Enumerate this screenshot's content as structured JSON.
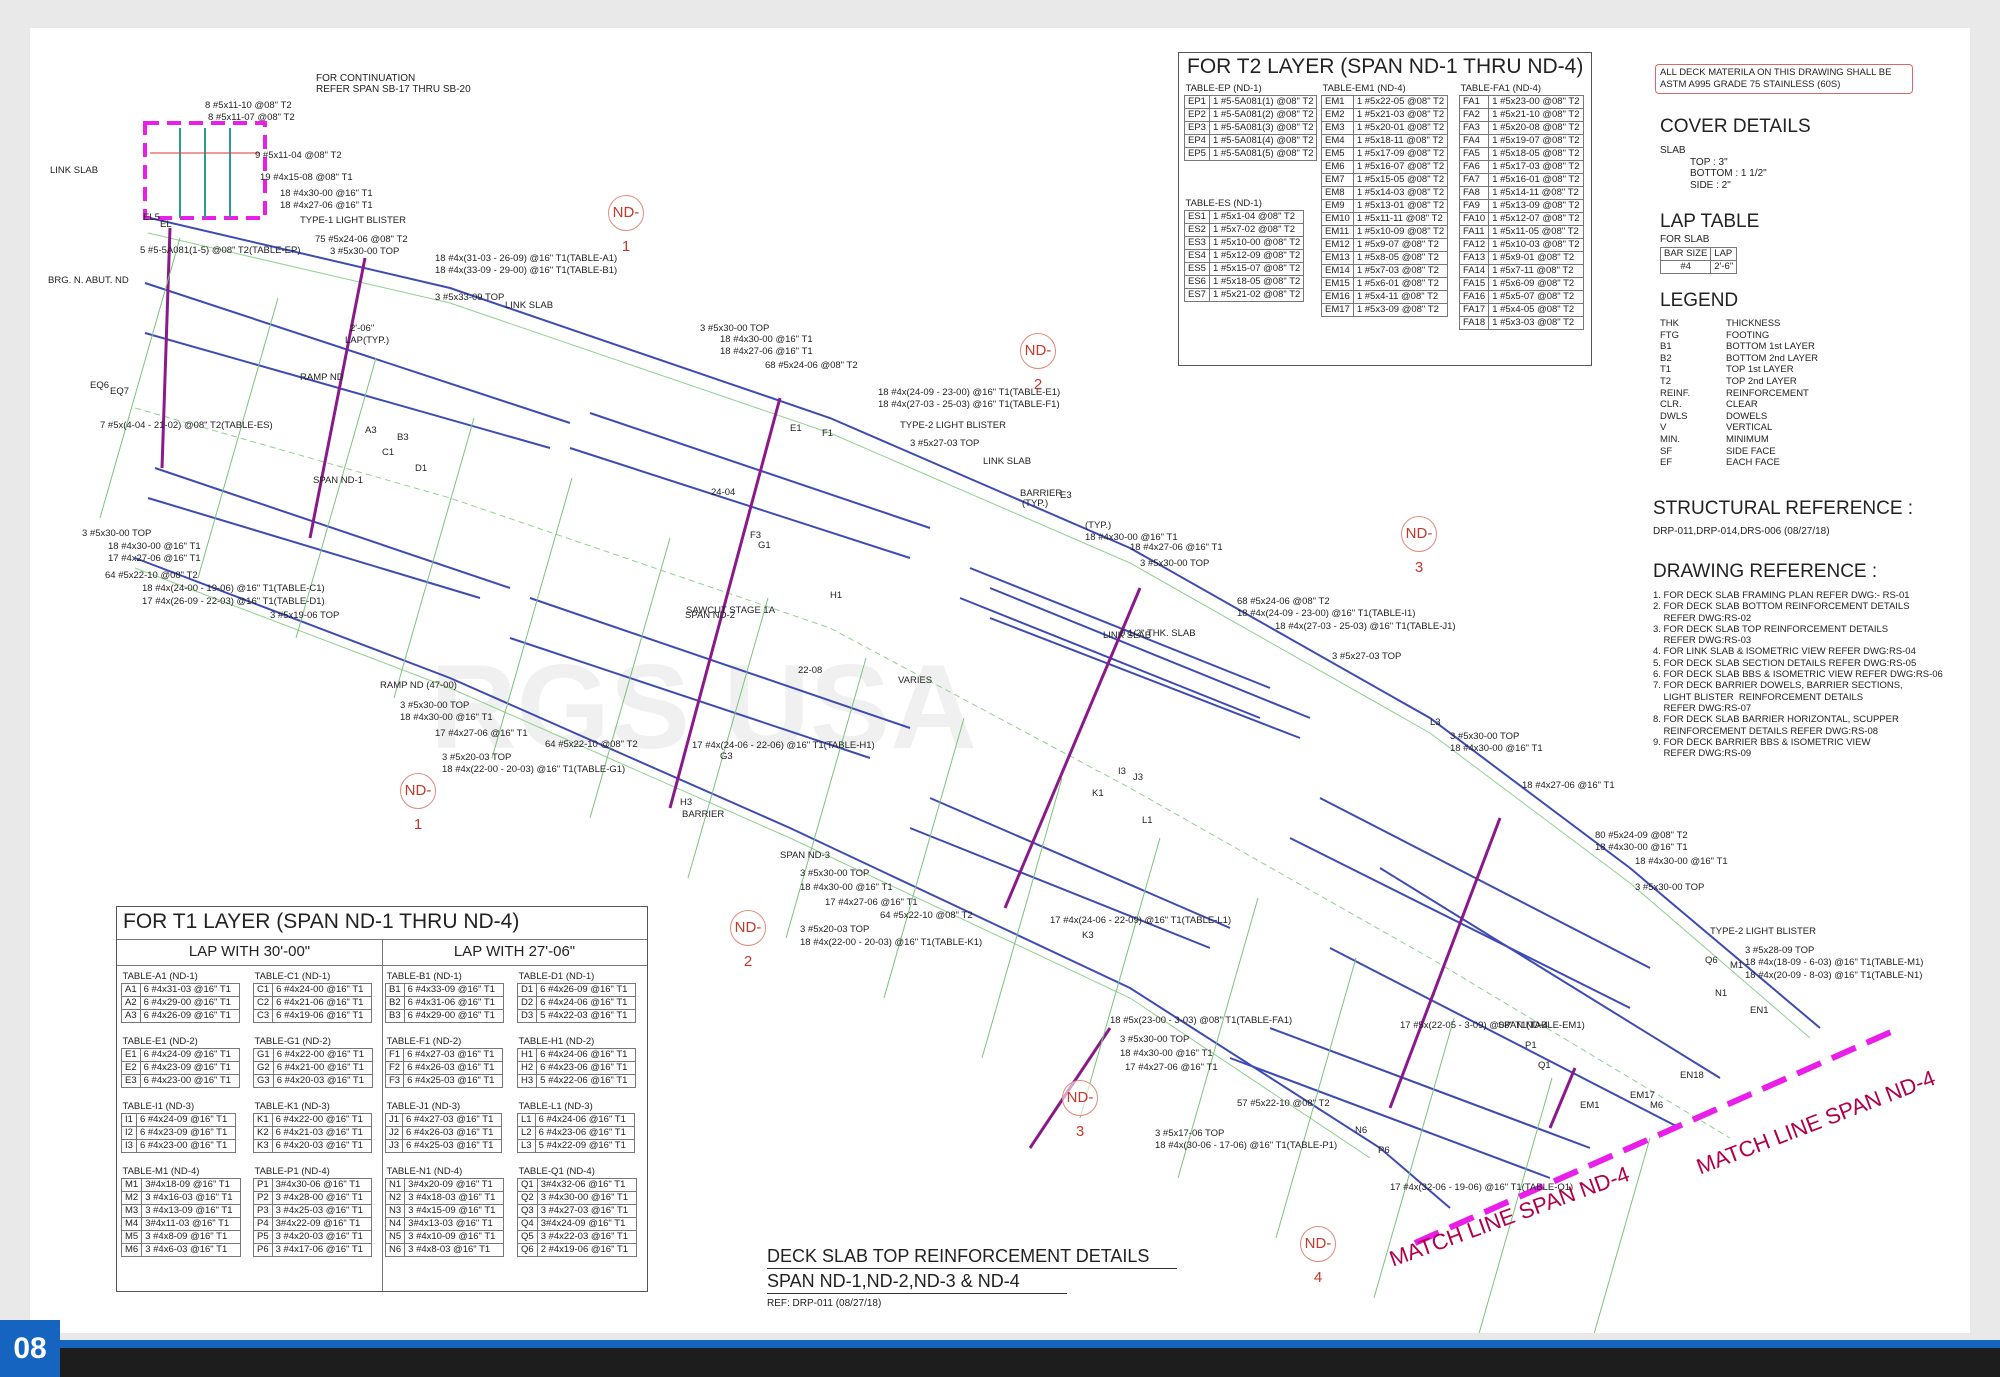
{
  "page_number": "08",
  "watermark": "RGS USA",
  "note_box": [
    "ALL DECK MATERILA ON THIS DRAWING SHALL BE",
    "ASTM A995 GRADE 75 STAINLESS (60S)"
  ],
  "continuation": [
    "FOR CONTINUATION",
    "REFER SPAN SB-17 THRU SB-20"
  ],
  "t2": {
    "title": "FOR T2 LAYER (SPAN ND-1 THRU ND-4)",
    "ep_title": "TABLE-EP (ND-1)",
    "ep": [
      [
        "EP1",
        "1 #5-5A081(1) @08\" T2"
      ],
      [
        "EP2",
        "1 #5-5A081(2) @08\" T2"
      ],
      [
        "EP3",
        "1 #5-5A081(3) @08\" T2"
      ],
      [
        "EP4",
        "1 #5-5A081(4) @08\" T2"
      ],
      [
        "EP5",
        "1 #5-5A081(5) @08\" T2"
      ]
    ],
    "es_title": "TABLE-ES (ND-1)",
    "es": [
      [
        "ES1",
        "1 #5x1-04 @08\" T2"
      ],
      [
        "ES2",
        "1 #5x7-02 @08\" T2"
      ],
      [
        "ES3",
        "1 #5x10-00 @08\" T2"
      ],
      [
        "ES4",
        "1 #5x12-09 @08\" T2"
      ],
      [
        "ES5",
        "1 #5x15-07 @08\" T2"
      ],
      [
        "ES6",
        "1 #5x18-05 @08\" T2"
      ],
      [
        "ES7",
        "1 #5x21-02 @08\" T2"
      ]
    ],
    "em_title": "TABLE-EM1 (ND-4)",
    "em": [
      [
        "EM1",
        "1 #5x22-05 @08\" T2"
      ],
      [
        "EM2",
        "1 #5x21-03 @08\" T2"
      ],
      [
        "EM3",
        "1 #5x20-01 @08\" T2"
      ],
      [
        "EM4",
        "1 #5x18-11 @08\" T2"
      ],
      [
        "EM5",
        "1 #5x17-09 @08\" T2"
      ],
      [
        "EM6",
        "1 #5x16-07 @08\" T2"
      ],
      [
        "EM7",
        "1 #5x15-05 @08\" T2"
      ],
      [
        "EM8",
        "1 #5x14-03 @08\" T2"
      ],
      [
        "EM9",
        "1 #5x13-01 @08\" T2"
      ],
      [
        "EM10",
        "1 #5x11-11 @08\" T2"
      ],
      [
        "EM11",
        "1 #5x10-09 @08\" T2"
      ],
      [
        "EM12",
        "1 #5x9-07 @08\" T2"
      ],
      [
        "EM13",
        "1 #5x8-05 @08\" T2"
      ],
      [
        "EM14",
        "1 #5x7-03 @08\" T2"
      ],
      [
        "EM15",
        "1 #5x6-01 @08\" T2"
      ],
      [
        "EM16",
        "1 #5x4-11 @08\" T2"
      ],
      [
        "EM17",
        "1 #5x3-09 @08\" T2"
      ]
    ],
    "fa_title": "TABLE-FA1 (ND-4)",
    "fa": [
      [
        "FA1",
        "1 #5x23-00 @08\" T2"
      ],
      [
        "FA2",
        "1 #5x21-10 @08\" T2"
      ],
      [
        "FA3",
        "1 #5x20-08 @08\" T2"
      ],
      [
        "FA4",
        "1 #5x19-07 @08\" T2"
      ],
      [
        "FA5",
        "1 #5x18-05 @08\" T2"
      ],
      [
        "FA6",
        "1 #5x17-03 @08\" T2"
      ],
      [
        "FA7",
        "1 #5x16-01 @08\" T2"
      ],
      [
        "FA8",
        "1 #5x14-11 @08\" T2"
      ],
      [
        "FA9",
        "1 #5x13-09 @08\" T2"
      ],
      [
        "FA10",
        "1 #5x12-07 @08\" T2"
      ],
      [
        "FA11",
        "1 #5x11-05 @08\" T2"
      ],
      [
        "FA12",
        "1 #5x10-03 @08\" T2"
      ],
      [
        "FA13",
        "1 #5x9-01 @08\" T2"
      ],
      [
        "FA14",
        "1 #5x7-11 @08\" T2"
      ],
      [
        "FA15",
        "1 #5x6-09 @08\" T2"
      ],
      [
        "FA16",
        "1 #5x5-07 @08\" T2"
      ],
      [
        "FA17",
        "1 #5x4-05 @08\" T2"
      ],
      [
        "FA18",
        "1 #5x3-03 @08\" T2"
      ]
    ]
  },
  "cover": {
    "title": "COVER DETAILS",
    "lines": [
      "SLAB",
      "TOP : 3\"",
      "BOTTOM : 1 1/2\"",
      "SIDE : 2\""
    ]
  },
  "lap": {
    "title": "LAP TABLE",
    "sub": "FOR SLAB",
    "head": [
      "BAR SIZE",
      "LAP"
    ],
    "row": [
      "#4",
      "2'-6\""
    ]
  },
  "legend": {
    "title": "LEGEND",
    "items": [
      [
        "THK",
        "THICKNESS"
      ],
      [
        "FTG",
        "FOOTING"
      ],
      [
        "B1",
        "BOTTOM 1st LAYER"
      ],
      [
        "B2",
        "BOTTOM 2nd LAYER"
      ],
      [
        "T1",
        "TOP 1st LAYER"
      ],
      [
        "T2",
        "TOP 2nd LAYER"
      ],
      [
        "REINF.",
        "REINFORCEMENT"
      ],
      [
        "CLR.",
        "CLEAR"
      ],
      [
        "DWLS",
        "DOWELS"
      ],
      [
        "V",
        "VERTICAL"
      ],
      [
        "MIN.",
        "MINIMUM"
      ],
      [
        "SF",
        "SIDE FACE"
      ],
      [
        "EF",
        "EACH FACE"
      ]
    ]
  },
  "structural_ref": {
    "title": "STRUCTURAL REFERENCE :",
    "text": "DRP-011,DRP-014,DRS-006 (08/27/18)"
  },
  "drawing_ref": {
    "title": "DRAWING REFERENCE :",
    "lines": [
      "1. FOR DECK SLAB FRAMING PLAN REFER DWG:- RS-01",
      "2. FOR DECK SLAB BOTTOM REINFORCEMENT DETAILS",
      "    REFER DWG:RS-02",
      "3. FOR DECK SLAB TOP REINFORCEMENT DETAILS",
      "    REFER DWG:RS-03",
      "4. FOR LINK SLAB & ISOMETRIC VIEW REFER DWG:RS-04",
      "5. FOR DECK SLAB SECTION DETAILS REFER DWG:RS-05",
      "6. FOR DECK SLAB BBS & ISOMETRIC VIEW REFER DWG:RS-06",
      "7. FOR DECK BARRIER DOWELS, BARRIER SECTIONS,",
      "    LIGHT BLISTER  REINFORCEMENT DETAILS",
      "    REFER DWG:RS-07",
      "8. FOR DECK SLAB BARRIER HORIZONTAL, SCUPPER",
      "    REINFORCEMENT DETAILS REFER DWG:RS-08",
      "9. FOR DECK BARRIER BBS & ISOMETRIC VIEW",
      "    REFER DWG:RS-09"
    ]
  },
  "t1": {
    "title": "FOR T1 LAYER (SPAN ND-1 THRU ND-4)",
    "lap30": "LAP WITH 30'-00\"",
    "lap27": "LAP WITH 27'-06\"",
    "groups": [
      {
        "name": "TABLE-A1 (ND-1)",
        "rows": [
          [
            "A1",
            "6 #4x31-03 @16\" T1"
          ],
          [
            "A2",
            "6 #4x29-00 @16\" T1"
          ],
          [
            "A3",
            "6 #4x26-09 @16\" T1"
          ]
        ]
      },
      {
        "name": "TABLE-C1 (ND-1)",
        "rows": [
          [
            "C1",
            "6 #4x24-00 @16\" T1"
          ],
          [
            "C2",
            "6 #4x21-06 @16\" T1"
          ],
          [
            "C3",
            "6 #4x19-06 @16\" T1"
          ]
        ]
      },
      {
        "name": "TABLE-B1 (ND-1)",
        "rows": [
          [
            "B1",
            "6 #4x33-09 @16\" T1"
          ],
          [
            "B2",
            "6 #4x31-06 @16\" T1"
          ],
          [
            "B3",
            "6 #4x29-00 @16\" T1"
          ]
        ]
      },
      {
        "name": "TABLE-D1 (ND-1)",
        "rows": [
          [
            "D1",
            "6 #4x26-09 @16\" T1"
          ],
          [
            "D2",
            "6 #4x24-06 @16\" T1"
          ],
          [
            "D3",
            "5 #4x22-03 @16\" T1"
          ]
        ]
      },
      {
        "name": "TABLE-E1 (ND-2)",
        "rows": [
          [
            "E1",
            "6 #4x24-09 @16\" T1"
          ],
          [
            "E2",
            "6 #4x23-09 @16\" T1"
          ],
          [
            "E3",
            "6 #4x23-00 @16\" T1"
          ]
        ]
      },
      {
        "name": "TABLE-G1 (ND-2)",
        "rows": [
          [
            "G1",
            "6 #4x22-00 @16\" T1"
          ],
          [
            "G2",
            "6 #4x21-00 @16\" T1"
          ],
          [
            "G3",
            "6 #4x20-03 @16\" T1"
          ]
        ]
      },
      {
        "name": "TABLE-F1 (ND-2)",
        "rows": [
          [
            "F1",
            "6 #4x27-03 @16\" T1"
          ],
          [
            "F2",
            "6 #4x26-03 @16\" T1"
          ],
          [
            "F3",
            "6 #4x25-03 @16\" T1"
          ]
        ]
      },
      {
        "name": "TABLE-H1 (ND-2)",
        "rows": [
          [
            "H1",
            "6 #4x24-06 @16\" T1"
          ],
          [
            "H2",
            "6 #4x23-06 @16\" T1"
          ],
          [
            "H3",
            "5 #4x22-06 @16\" T1"
          ]
        ]
      },
      {
        "name": "TABLE-I1 (ND-3)",
        "rows": [
          [
            "I1",
            "6 #4x24-09 @16\" T1"
          ],
          [
            "I2",
            "6 #4x23-09 @16\" T1"
          ],
          [
            "I3",
            "6 #4x23-00 @16\" T1"
          ]
        ]
      },
      {
        "name": "TABLE-K1 (ND-3)",
        "rows": [
          [
            "K1",
            "6 #4x22-00 @16\" T1"
          ],
          [
            "K2",
            "6 #4x21-03 @16\" T1"
          ],
          [
            "K3",
            "6 #4x20-03 @16\" T1"
          ]
        ]
      },
      {
        "name": "TABLE-J1 (ND-3)",
        "rows": [
          [
            "J1",
            "6 #4x27-03 @16\" T1"
          ],
          [
            "J2",
            "6 #4x26-03 @16\" T1"
          ],
          [
            "J3",
            "6 #4x25-03 @16\" T1"
          ]
        ]
      },
      {
        "name": "TABLE-L1 (ND-3)",
        "rows": [
          [
            "L1",
            "6 #4x24-06 @16\" T1"
          ],
          [
            "L2",
            "6 #4x23-06 @16\" T1"
          ],
          [
            "L3",
            "5 #4x22-09 @16\" T1"
          ]
        ]
      },
      {
        "name": "TABLE-M1 (ND-4)",
        "rows": [
          [
            "M1",
            "3#4x18-09 @16\" T1"
          ],
          [
            "M2",
            "3 #4x16-03 @16\" T1"
          ],
          [
            "M3",
            "3 #4x13-09 @16\" T1"
          ],
          [
            "M4",
            "3#4x11-03 @16\" T1"
          ],
          [
            "M5",
            "3 #4x8-09 @16\" T1"
          ],
          [
            "M6",
            "3 #4x6-03 @16\" T1"
          ]
        ]
      },
      {
        "name": "TABLE-P1 (ND-4)",
        "rows": [
          [
            "P1",
            "3#4x30-06 @16\" T1"
          ],
          [
            "P2",
            "3 #4x28-00 @16\" T1"
          ],
          [
            "P3",
            "3 #4x25-03 @16\" T1"
          ],
          [
            "P4",
            "3#4x22-09 @16\" T1"
          ],
          [
            "P5",
            "3 #4x20-03 @16\" T1"
          ],
          [
            "P6",
            "3 #4x17-06 @16\" T1"
          ]
        ]
      },
      {
        "name": "TABLE-N1 (ND-4)",
        "rows": [
          [
            "N1",
            "3#4x20-09 @16\" T1"
          ],
          [
            "N2",
            "3 #4x18-03 @16\" T1"
          ],
          [
            "N3",
            "3 #4x15-09 @16\" T1"
          ],
          [
            "N4",
            "3#4x13-03 @16\" T1"
          ],
          [
            "N5",
            "3 #4x10-09 @16\" T1"
          ],
          [
            "N6",
            "3 #4x8-03 @16\" T1"
          ]
        ]
      },
      {
        "name": "TABLE-Q1 (ND-4)",
        "rows": [
          [
            "Q1",
            "3#4x32-06 @16\" T1"
          ],
          [
            "Q2",
            "3 #4x30-00 @16\" T1"
          ],
          [
            "Q3",
            "3 #4x27-03 @16\" T1"
          ],
          [
            "Q4",
            "3#4x24-09 @16\" T1"
          ],
          [
            "Q5",
            "3 #4x22-03 @16\" T1"
          ],
          [
            "Q6",
            "2 #4x19-06 @16\" T1"
          ]
        ]
      }
    ]
  },
  "drawing_title": {
    "line1": "DECK SLAB TOP REINFORCEMENT DETAILS",
    "line2": "SPAN ND-1,ND-2,ND-3 & ND-4",
    "ref": "REF: DRP-011 (08/27/18)"
  },
  "match_line": "MATCH LINE SPAN ND-4",
  "nd_markers": [
    "ND-1",
    "ND-2",
    "ND-3",
    "ND-1",
    "ND-2",
    "ND-3",
    "ND-4"
  ],
  "plan_labels": [
    "8 #5x11-10 @08\" T2",
    "8 #5x11-07 @08\" T2",
    "9 #5x11-04 @08\" T2",
    "19 #4x15-08 @08\" T1",
    "18 #4x30-00 @16\" T1",
    "18 #4x27-06 @16\" T1",
    "TYPE-1 LIGHT BLISTER",
    "75 #5x24-06 @08\" T2",
    "3 #5x30-00 TOP",
    "18 #4x(31-03 - 26-09) @16\" T1(TABLE-A1)",
    "18 #4x(33-09 - 29-00) @16\" T1(TABLE-B1)",
    "3 #5x33-09 TOP",
    "LINK SLAB",
    "BRG. N. ABUT. ND",
    "EL5",
    "EL",
    "5 #5-5A081(1-5) @08\" T2(TABLE-EP)",
    "2'-06\"",
    "LAP(TYP.)",
    "RAMP ND",
    "EQ6",
    "EQ7",
    "7 #5x(4-04 - 21-02) @08\" T2(TABLE-ES)",
    "A3",
    "B3",
    "C1",
    "D1",
    "SPAN ND-1",
    "3 #5x30-00 TOP",
    "18 #4x30-00 @16\" T1",
    "17 #4x27-06 @16\" T1",
    "64 #5x22-10 @08\" T2",
    "18 #4x(24-00 - 19-06) @16\" T1(TABLE-C1)",
    "17 #4x(26-09 - 22-03) @16\" T1(TABLE-D1)",
    "3 #5x19-06 TOP",
    "3 #5x30-00 TOP",
    "18 #4x30-00 @16\" T1",
    "18 #4x27-06 @16\" T1",
    "68 #5x24-06 @08\" T2",
    "18 #4x(24-09 - 23-00) @16\" T1(TABLE-E1)",
    "18 #4x(27-03 - 25-03) @16\" T1(TABLE-F1)",
    "TYPE-2 LIGHT BLISTER",
    "3 #5x27-03 TOP",
    "LINK SLAB",
    "BARRIER",
    "(TYP.)",
    "E1",
    "F1",
    "24-04",
    "E3",
    "F3",
    "G1",
    "H1",
    "SAWCUT STAGE 1A",
    "SPAN ND-2",
    "22-08",
    "VARIES",
    "RAMP ND (47-00)",
    "3 #5x30-00 TOP",
    "18 #4x30-00 @16\" T1",
    "17 #4x27-06 @16\" T1",
    "64 #5x22-10 @08\" T2",
    "3 #5x20-03 TOP",
    "18 #4x(22-00 - 20-03) @16\" T1(TABLE-G1)",
    "17 #4x(24-06 - 22-06) @16\" T1(TABLE-H1)",
    "G3",
    "H3",
    "BARRIER",
    "(TYP.)",
    "18 #4x30-00 @16\" T1",
    "18 #4x27-06 @16\" T1",
    "3 #5x30-00 TOP",
    "68 #5x24-06 @08\" T2",
    "18 #4x(24-09 - 23-00) @16\" T1(TABLE-I1)",
    "18 #4x(27-03 - 25-03) @16\" T1(TABLE-J1)",
    "3 #5x27-03 TOP",
    "LINK SLAB",
    "9 1/2\" THK. SLAB",
    "I3",
    "J3",
    "K1",
    "L1",
    "SPAN ND-3",
    "3 #5x30-00 TOP",
    "18 #4x30-00 @16\" T1",
    "17 #4x27-06 @16\" T1",
    "64 #5x22-10 @08\" T2",
    "3 #5x20-03 TOP",
    "18 #4x(22-00 - 20-03) @16\" T1(TABLE-K1)",
    "17 #4x(24-06 - 22-09) @16\" T1(TABLE-L1)",
    "K3",
    "L3",
    "3 #5x30-00 TOP",
    "18 #4x30-00 @16\" T1",
    "18 #4x27-06 @16\" T1",
    "80 #5x24-09 @08\" T2",
    "18 #4x30-00 @16\" T1",
    "18 #4x30-00 @16\" T1",
    "3 #5x30-00 TOP",
    "TYPE-2 LIGHT BLISTER",
    "3 #5x28-09 TOP",
    "18 #4x(18-09 - 6-03) @16\" T1(TABLE-M1)",
    "18 #4x(20-09 - 8-03) @16\" T1(TABLE-N1)",
    "18 #5x(23-00 - 3-03) @08\" T1(TABLE-FA1)",
    "3 #5x30-00 TOP",
    "18 #4x30-00 @16\" T1",
    "17 #4x27-06 @16\" T1",
    "57 #5x22-10 @08\" T2",
    "3 #5x17-06 TOP",
    "18 #4x(30-06 - 17-06) @16\" T1(TABLE-P1)",
    "17 #4x(32-06 - 19-06) @16\" T1(TABLE-Q1)",
    "17 #5x(22-05 - 3-09) @08\" T1(TABLE-EM1)",
    "SPAN ND-4",
    "P1",
    "Q1",
    "EM1",
    "EM17",
    "M6",
    "N6",
    "P6",
    "Q6",
    "M1",
    "N1",
    "EN1",
    "EN18",
    "LINK SLAB"
  ]
}
